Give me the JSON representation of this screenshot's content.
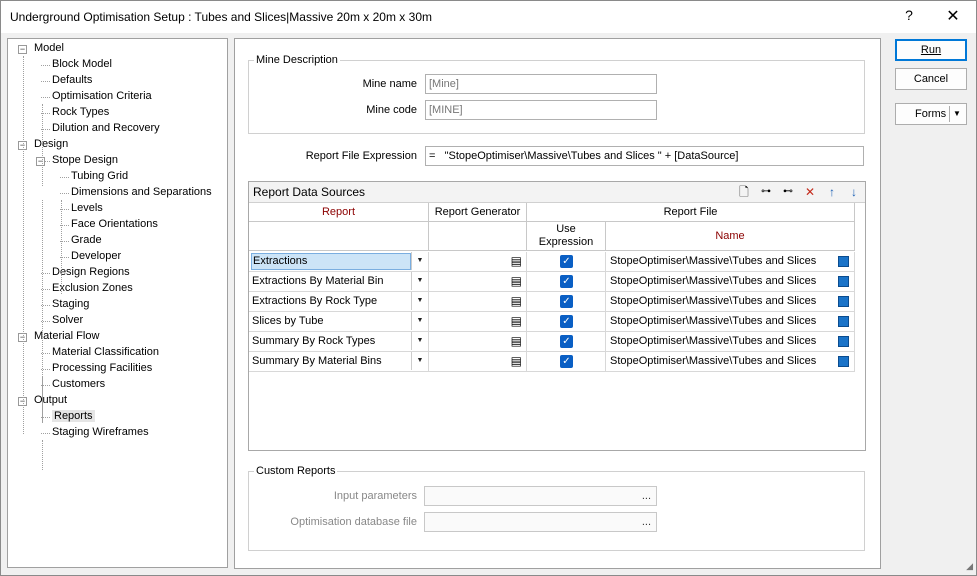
{
  "window": {
    "title": "Underground Optimisation Setup : Tubes and Slices|Massive 20m x 20m x 30m",
    "help_label": "?",
    "close_label": "✕"
  },
  "tree": [
    {
      "label": "Model",
      "depth": 0,
      "expander": "⊟"
    },
    {
      "label": "Block Model",
      "depth": 1
    },
    {
      "label": "Defaults",
      "depth": 1
    },
    {
      "label": "Optimisation Criteria",
      "depth": 1
    },
    {
      "label": "Rock Types",
      "depth": 1
    },
    {
      "label": "Dilution and Recovery",
      "depth": 1
    },
    {
      "label": "Design",
      "depth": 0,
      "expander": "⊟"
    },
    {
      "label": "Stope Design",
      "depth": 1,
      "expander": "⊟"
    },
    {
      "label": "Tubing Grid",
      "depth": 2
    },
    {
      "label": "Dimensions and Separations",
      "depth": 2
    },
    {
      "label": "Levels",
      "depth": 2
    },
    {
      "label": "Face Orientations",
      "depth": 2
    },
    {
      "label": "Grade",
      "depth": 2
    },
    {
      "label": "Developer",
      "depth": 2
    },
    {
      "label": "Design Regions",
      "depth": 1
    },
    {
      "label": "Exclusion Zones",
      "depth": 1
    },
    {
      "label": "Staging",
      "depth": 1
    },
    {
      "label": "Solver",
      "depth": 1
    },
    {
      "label": "Material Flow",
      "depth": 0,
      "expander": "⊟"
    },
    {
      "label": "Material Classification",
      "depth": 1
    },
    {
      "label": "Processing Facilities",
      "depth": 1
    },
    {
      "label": "Customers",
      "depth": 1
    },
    {
      "label": "Output",
      "depth": 0,
      "expander": "⊟"
    },
    {
      "label": "Reports",
      "depth": 1,
      "selected": true
    },
    {
      "label": "Staging Wireframes",
      "depth": 1
    }
  ],
  "mine_description": {
    "group_title": "Mine Description",
    "mine_name_label": "Mine name",
    "mine_name_value": "[Mine]",
    "mine_code_label": "Mine code",
    "mine_code_value": "[MINE]"
  },
  "report_file_expression": {
    "label": "Report File Expression",
    "value": "=   \"StopeOptimiser\\Massive\\Tubes and Slices \" + [DataSource]"
  },
  "report_data_sources": {
    "title": "Report Data Sources",
    "toolbar_icons": [
      "new-icon",
      "insert-icon",
      "append-icon",
      "delete-icon",
      "move-up-icon",
      "move-down-icon"
    ],
    "headers": {
      "report": "Report",
      "report_generator": "Report Generator",
      "report_file": "Report File",
      "use_expression": "Use\nExpression",
      "name": "Name"
    },
    "rows": [
      {
        "report": "Extractions",
        "use_expression": true,
        "name": "StopeOptimiser\\Massive\\Tubes and Slices"
      },
      {
        "report": "Extractions By Material Bin",
        "use_expression": true,
        "name": "StopeOptimiser\\Massive\\Tubes and Slices"
      },
      {
        "report": "Extractions By Rock Type",
        "use_expression": true,
        "name": "StopeOptimiser\\Massive\\Tubes and Slices"
      },
      {
        "report": "Slices by Tube",
        "use_expression": true,
        "name": "StopeOptimiser\\Massive\\Tubes and Slices"
      },
      {
        "report": "Summary By Rock Types",
        "use_expression": true,
        "name": "StopeOptimiser\\Massive\\Tubes and Slices"
      },
      {
        "report": "Summary By Material Bins",
        "use_expression": true,
        "name": "StopeOptimiser\\Massive\\Tubes and Slices"
      }
    ],
    "report_color": "#8b0000",
    "checkbox_color": "#0a5fc4"
  },
  "custom_reports": {
    "group_title": "Custom Reports",
    "input_parameters_label": "Input parameters",
    "input_parameters_value": "",
    "optimisation_db_label": "Optimisation database file",
    "optimisation_db_value": "",
    "browse_label": "..."
  },
  "buttons": {
    "run": "Run",
    "cancel": "Cancel",
    "forms": "Forms"
  }
}
